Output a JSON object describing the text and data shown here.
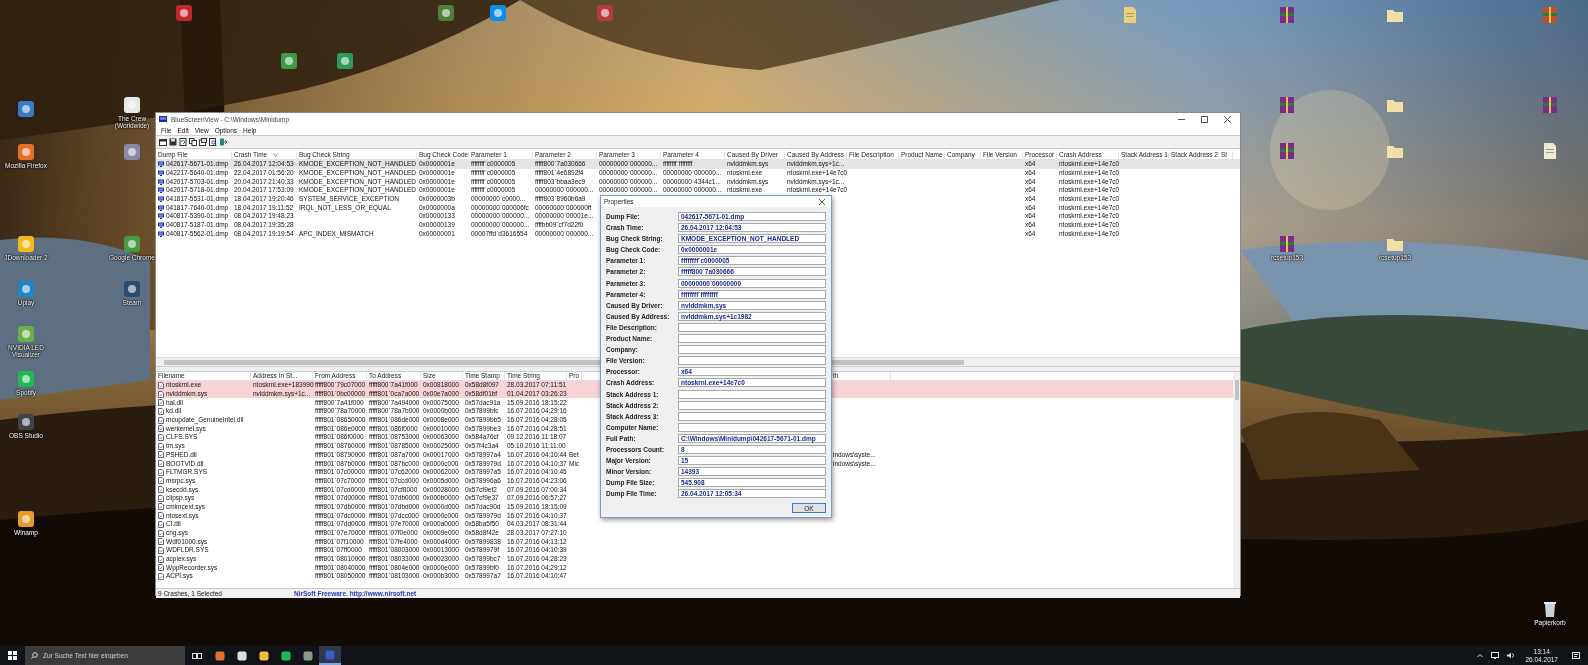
{
  "desktop_icons": [
    {
      "kind": "app",
      "color": "#c0282d"
    },
    {
      "kind": "app",
      "color": "#4f7f3a"
    },
    {
      "kind": "app",
      "color": "#0e8ee9"
    },
    {
      "kind": "app",
      "color": "#b83a3a"
    },
    {
      "kind": "app",
      "color": "#3c9a4a"
    },
    {
      "kind": "app",
      "color": "#2f9a5e"
    },
    {
      "kind": "document",
      "color": "#e8d27a"
    },
    {
      "kind": "archive",
      "color": "#7a2d8a"
    },
    {
      "kind": "folder",
      "color": "#f0e0a8"
    },
    {
      "kind": "archive",
      "color": "#b8502e"
    },
    {
      "kind": "app",
      "color": "#e8e8e8",
      "label": "The Crew (Worldwide)"
    },
    {
      "kind": "app",
      "color": "#3a78c8"
    },
    {
      "kind": "app",
      "color": "#e5702a",
      "label": "Mozilla Firefox"
    },
    {
      "kind": "app",
      "color": "#8a8aa8"
    },
    {
      "kind": "archive",
      "color": "#7a2d8a"
    },
    {
      "kind": "folder",
      "color": "#f0e0a8"
    },
    {
      "kind": "archive",
      "color": "#7a2d8a"
    },
    {
      "kind": "archive",
      "color": "#7a2d8a"
    },
    {
      "kind": "folder",
      "color": "#f0e0a8"
    },
    {
      "kind": "document",
      "color": "#f2ead0"
    },
    {
      "kind": "app",
      "color": "#f2b91c",
      "label": "JDownloader 2"
    },
    {
      "kind": "app",
      "color": "#4a9a44",
      "label": "Google Chrome"
    },
    {
      "kind": "archive",
      "color": "#7a2d8a",
      "label": "rcsetup153"
    },
    {
      "kind": "folder",
      "color": "#f0e0a8",
      "label": "rcsetup153"
    },
    {
      "kind": "app",
      "color": "#1e86c8",
      "label": "Uplay"
    },
    {
      "kind": "app",
      "color": "#2a4c6e",
      "label": "Steam"
    },
    {
      "kind": "app",
      "color": "#6ab04a",
      "label": "NVIDIA LED Visualizer"
    },
    {
      "kind": "app",
      "color": "#1db954",
      "label": "Spotify"
    },
    {
      "kind": "app",
      "color": "#404448",
      "label": "OBS Studio"
    },
    {
      "kind": "app",
      "color": "#e89a2a",
      "label": "Winamp"
    },
    {
      "kind": "bin",
      "color": "#c8d0d8",
      "label": "Papierkorb"
    }
  ],
  "window": {
    "title": "BlueScreenView  -  C:\\Windows\\Minidump",
    "menu": [
      "File",
      "Edit",
      "View",
      "Options",
      "Help"
    ],
    "crash_table": {
      "columns": [
        "Dump File",
        "Crash Time",
        "Bug Check String",
        "Bug Check Code",
        "Parameter 1",
        "Parameter 2",
        "Parameter 3",
        "Parameter 4",
        "Caused By Driver",
        "Caused By Address",
        "File Description",
        "Product Name",
        "Company",
        "File Version",
        "Processor",
        "Crash Address",
        "Stack Address 1",
        "Stack Address 2",
        "St"
      ],
      "rows": [
        {
          "selected": true,
          "dump_file": "042617-5671-01.dmp",
          "crash_time": "26.04.2017 12:04:53",
          "bug_check_string": "KMODE_EXCEPTION_NOT_HANDLED",
          "bug_check_code": "0x0000001e",
          "parameter_1": "ffffffff`c0000005",
          "parameter_2": "fffff800`7a030666",
          "parameter_3": "00000000`000000...",
          "parameter_4": "ffffffff`ffffffff",
          "caused_by_driver": "nvlddmkm.sys",
          "caused_by_address": "nvlddmkm.sys+1c...",
          "processor": "x64",
          "crash_address": "ntoskrnl.exe+14e7c0"
        },
        {
          "selected": false,
          "dump_file": "042217-5640-01.dmp",
          "crash_time": "22.04.2017 01:56:20",
          "bug_check_string": "KMODE_EXCEPTION_NOT_HANDLED",
          "bug_check_code": "0x0000001e",
          "parameter_1": "ffffffff`c0000005",
          "parameter_2": "fffff801`4e6892f4",
          "parameter_3": "00000000`000000...",
          "parameter_4": "00000000`000000...",
          "caused_by_driver": "ntoskrnl.exe",
          "caused_by_address": "ntoskrnl.exe+14e7c0",
          "processor": "x64",
          "crash_address": "ntoskrnl.exe+14e7c0"
        },
        {
          "selected": false,
          "dump_file": "042017-5703-01.dmp",
          "crash_time": "20.04.2017 21:40:33",
          "bug_check_string": "KMODE_EXCEPTION_NOT_HANDLED",
          "bug_check_code": "0x0000001e",
          "parameter_1": "ffffffff`c0000005",
          "parameter_2": "fffff803`bbaa3ec9",
          "parameter_3": "00000000`000000...",
          "parameter_4": "00000000`4344c1...",
          "caused_by_driver": "nvlddmkm.sys",
          "caused_by_address": "nvlddmkm.sys+1c...",
          "processor": "x64",
          "crash_address": "ntoskrnl.exe+14e7c0"
        },
        {
          "selected": false,
          "dump_file": "042017-5718-01.dmp",
          "crash_time": "20.04.2017 17:53:09",
          "bug_check_string": "KMODE_EXCEPTION_NOT_HANDLED",
          "bug_check_code": "0x0000001e",
          "parameter_1": "ffffffff`c0000005",
          "parameter_2": "00000000`000000...",
          "parameter_3": "00000000`000000...",
          "parameter_4": "00000000`000000...",
          "caused_by_driver": "ntoskrnl.exe",
          "caused_by_address": "ntoskrnl.exe+14e7c0",
          "processor": "x64",
          "crash_address": "ntoskrnl.exe+14e7c0"
        },
        {
          "selected": false,
          "dump_file": "041817-5531-01.dmp",
          "crash_time": "18.04.2017 19:20:46",
          "bug_check_string": "SYSTEM_SERVICE_EXCEPTION",
          "bug_check_code": "0x0000003b",
          "parameter_1": "00000000`c0000...",
          "parameter_2": "fffff803`8960b6a9",
          "processor": "x64",
          "crash_address": "ntoskrnl.exe+14e7c0"
        },
        {
          "selected": false,
          "dump_file": "041817-7640-01.dmp",
          "crash_time": "18.04.2017 19:11:52",
          "bug_check_string": "IRQL_NOT_LESS_OR_EQUAL",
          "bug_check_code": "0x0000000a",
          "parameter_1": "00000000`000006fc",
          "parameter_2": "00000000`000000ff",
          "processor": "x64",
          "crash_address": "ntoskrnl.exe+14e7c0"
        },
        {
          "selected": false,
          "dump_file": "040817-5390-01.dmp",
          "crash_time": "08.04.2017 19:48:23",
          "bug_check_code": "0x00000133",
          "parameter_1": "00000000`000000...",
          "parameter_2": "00000000`00001e...",
          "processor": "x64",
          "crash_address": "ntoskrnl.exe+14e7c0"
        },
        {
          "selected": false,
          "dump_file": "040817-5187-01.dmp",
          "crash_time": "08.04.2017 19:35:28",
          "bug_check_code": "0x00000139",
          "parameter_1": "00000000`000000...",
          "parameter_2": "ffffbb09`cf7d22f0",
          "processor": "x64",
          "crash_address": "ntoskrnl.exe+14e7c0"
        },
        {
          "selected": false,
          "dump_file": "040817-5562-01.dmp",
          "crash_time": "08.04.2017 19:19:54",
          "bug_check_string": "APC_INDEX_MISMATCH",
          "bug_check_code": "0x00000001",
          "parameter_1": "00007ffd`d3616554",
          "parameter_2": "00000000`000000...",
          "processor": "x64",
          "crash_address": "ntoskrnl.exe+14e7c0"
        }
      ]
    },
    "driver_table": {
      "columns": [
        "Filename",
        "Address In St...",
        "From Address",
        "To Address",
        "Size",
        "Time Stamp",
        "Time String",
        "Pro",
        "th"
      ],
      "rows": [
        {
          "highlighted": true,
          "filename": "ntoskrnl.exe",
          "address_in_stack": "ntoskrnl.exe+183990",
          "from_address": "fffff800`79c07000",
          "to_address": "fffff800`7a41f000",
          "size": "0x00818000",
          "time_stamp": "0x58d8f097",
          "time_string": "28.03.2017 07:11:51"
        },
        {
          "highlighted": true,
          "filename": "nvlddmkm.sys",
          "address_in_stack": "nvlddmkm.sys+1c...",
          "from_address": "fffff801`0bc00000",
          "to_address": "fffff801`0ca7a000",
          "size": "0x00e7a000",
          "time_stamp": "0x58df01bf",
          "time_string": "01.04.2017 03:26:23"
        },
        {
          "highlighted": false,
          "filename": "hal.dll",
          "from_address": "fffff800`7a41f000",
          "to_address": "fffff800`7a494000",
          "size": "0x00075000",
          "time_stamp": "0x57dac91a",
          "time_string": "15.09.2016 18:15:22"
        },
        {
          "highlighted": false,
          "filename": "kd.dll",
          "from_address": "fffff800`78a70000",
          "to_address": "fffff800`78a7b000",
          "size": "0x0000b000",
          "time_stamp": "0x57899bfc",
          "time_string": "16.07.2016 04:29:16"
        },
        {
          "highlighted": false,
          "filename": "mcupdate_GenuineIntel.dll",
          "from_address": "fffff801`08650000",
          "to_address": "fffff801`086de000",
          "size": "0x0008e000",
          "time_stamp": "0x57899bb5",
          "time_string": "16.07.2016 04:28:05"
        },
        {
          "highlighted": false,
          "filename": "werkernel.sys",
          "from_address": "fffff801`086e0000",
          "to_address": "fffff801`086f0000",
          "size": "0x00010000",
          "time_stamp": "0x57899be3",
          "time_string": "16.07.2016 04:28:51"
        },
        {
          "highlighted": false,
          "filename": "CLFS.SYS",
          "from_address": "fffff801`086f0000",
          "to_address": "fffff801`08753000",
          "size": "0x00063000",
          "time_stamp": "0x584a76cf",
          "time_string": "09.12.2016 11:18:07"
        },
        {
          "highlighted": false,
          "filename": "tm.sys",
          "from_address": "fffff801`08760000",
          "to_address": "fffff801`08785000",
          "size": "0x00025000",
          "time_stamp": "0x57f4c3a4",
          "time_string": "05.10.2016 11:11:00"
        },
        {
          "highlighted": false,
          "filename": "PSHED.dll",
          "from_address": "fffff801`08790000",
          "to_address": "fffff801`087a7000",
          "size": "0x00017000",
          "time_stamp": "0x578997a4",
          "time_string": "16.07.2016 04:10:44",
          "column_8": "Bet",
          "column_9": "indows\\syste..."
        },
        {
          "highlighted": false,
          "filename": "BOOTVID.dll",
          "from_address": "fffff801`087b0000",
          "to_address": "fffff801`087bc000",
          "size": "0x0000c000",
          "time_stamp": "0x5789979d",
          "time_string": "16.07.2016 04:10:37",
          "column_8": "Mic",
          "column_9": "indows\\syste..."
        },
        {
          "highlighted": false,
          "filename": "FLTMGR.SYS",
          "from_address": "fffff801`07c00000",
          "to_address": "fffff801`07c62000",
          "size": "0x00062000",
          "time_stamp": "0x578997a5",
          "time_string": "16.07.2016 04:10:45"
        },
        {
          "highlighted": false,
          "filename": "msrpc.sys",
          "from_address": "fffff801`07c70000",
          "to_address": "fffff801`07ccd000",
          "size": "0x0005d000",
          "time_stamp": "0x578996a6",
          "time_string": "16.07.2016 04:23:06"
        },
        {
          "highlighted": false,
          "filename": "ksecdd.sys",
          "from_address": "fffff801`07cd0000",
          "to_address": "fffff801`07cf8000",
          "size": "0x00028000",
          "time_stamp": "0x57cf9ef2",
          "time_string": "07.09.2016 07:00:34"
        },
        {
          "highlighted": false,
          "filename": "clipsp.sys",
          "from_address": "fffff801`07d00000",
          "to_address": "fffff801`07db0000",
          "size": "0x000b0000",
          "time_stamp": "0x57cf9e37",
          "time_string": "07.09.2016 06:57:27"
        },
        {
          "highlighted": false,
          "filename": "cmimcext.sys",
          "from_address": "fffff801`07db0000",
          "to_address": "fffff801`07dbd000",
          "size": "0x0000d000",
          "time_stamp": "0x57dac90d",
          "time_string": "15.09.2016 18:15:09"
        },
        {
          "highlighted": false,
          "filename": "ntosext.sys",
          "from_address": "fffff801`07dc0000",
          "to_address": "fffff801`07dcc000",
          "size": "0x0000c000",
          "time_stamp": "0x5789979d",
          "time_string": "16.07.2016 04:10:37"
        },
        {
          "highlighted": false,
          "filename": "CI.dll",
          "from_address": "fffff801`07dd0000",
          "to_address": "fffff801`07e70000",
          "size": "0x000a0000",
          "time_stamp": "0x58ba5f50",
          "time_string": "04.03.2017 08:31:44"
        },
        {
          "highlighted": false,
          "filename": "cng.sys",
          "from_address": "fffff801`07e70000",
          "to_address": "fffff801`07f0e000",
          "size": "0x0009e000",
          "time_stamp": "0x58d8f42e",
          "time_string": "28.03.2017 07:27:10"
        },
        {
          "highlighted": false,
          "filename": "Wdf01000.sys",
          "from_address": "fffff801`07f10000",
          "to_address": "fffff801`07fe4000",
          "size": "0x000d4000",
          "time_stamp": "0x57899838",
          "time_string": "16.07.2016 04:13:12"
        },
        {
          "highlighted": false,
          "filename": "WDFLDR.SYS",
          "from_address": "fffff801`07ff0000",
          "to_address": "fffff801`08003000",
          "size": "0x00013000",
          "time_stamp": "0x5789979f",
          "time_string": "16.07.2016 04:10:39"
        },
        {
          "highlighted": false,
          "filename": "acpiex.sys",
          "from_address": "fffff801`08010000",
          "to_address": "fffff801`08033000",
          "size": "0x00023000",
          "time_stamp": "0x57899bc7",
          "time_string": "16.07.2016 04:28:23"
        },
        {
          "highlighted": false,
          "filename": "WppRecorder.sys",
          "from_address": "fffff801`08040000",
          "to_address": "fffff801`0804e000",
          "size": "0x0000e000",
          "time_stamp": "0x57899bf0",
          "time_string": "16.07.2016 04:29:12"
        },
        {
          "highlighted": false,
          "filename": "ACPI.sys",
          "from_address": "fffff801`08050000",
          "to_address": "fffff801`08103000",
          "size": "0x000b3000",
          "time_stamp": "0x578997a7",
          "time_string": "16.07.2016 04:10:47"
        }
      ]
    },
    "status_bar": {
      "count": "9 Crashes, 1 Selected",
      "credit": "NirSoft Freeware.  http://www.nirsoft.net"
    }
  },
  "properties_dialog": {
    "title": "Properties",
    "fields": [
      {
        "label": "Dump File:",
        "value": "042617-5671-01.dmp"
      },
      {
        "label": "Crash Time:",
        "value": "26.04.2017 12:04:53"
      },
      {
        "label": "Bug Check String:",
        "value": "KMODE_EXCEPTION_NOT_HANDLED"
      },
      {
        "label": "Bug Check Code:",
        "value": "0x0000001e"
      },
      {
        "label": "Parameter 1:",
        "value": "ffffffff`c0000005"
      },
      {
        "label": "Parameter 2:",
        "value": "fffff800`7a030666"
      },
      {
        "label": "Parameter 3:",
        "value": "00000000`00000000"
      },
      {
        "label": "Parameter 4:",
        "value": "ffffffff`ffffffff"
      },
      {
        "label": "Caused By Driver:",
        "value": "nvlddmkm.sys"
      },
      {
        "label": "Caused By Address:",
        "value": "nvlddmkm.sys+1c1982"
      },
      {
        "label": "File Description:"
      },
      {
        "label": "Product Name:"
      },
      {
        "label": "Company:"
      },
      {
        "label": "File Version:"
      },
      {
        "label": "Processor:",
        "value": "x64"
      },
      {
        "label": "Crash Address:",
        "value": "ntoskrnl.exe+14e7c0"
      },
      {
        "label": "Stack Address 1:"
      },
      {
        "label": "Stack Address 2:"
      },
      {
        "label": "Stack Address 3:"
      },
      {
        "label": "Computer Name:"
      },
      {
        "label": "Full Path:",
        "value": "C:\\Windows\\Minidump\\042617-5671-01.dmp"
      },
      {
        "label": "Processors Count:",
        "value": "8"
      },
      {
        "label": "Major Version:",
        "value": "15"
      },
      {
        "label": "Minor Version:",
        "value": "14393"
      },
      {
        "label": "Dump File Size:",
        "value": "545.908"
      },
      {
        "label": "Dump File Time:",
        "value": "26.04.2017 12:05:34"
      }
    ],
    "ok_button": "OK"
  },
  "taskbar": {
    "search_placeholder": "Zur Suche Text hier eingeben",
    "apps": [
      {
        "color": "#e5702a",
        "active": false
      },
      {
        "color": "#dddddd",
        "active": false
      },
      {
        "color": "#f0c040",
        "active": false
      },
      {
        "color": "#1db954",
        "active": false
      },
      {
        "color": "#8a9a8a",
        "active": false
      },
      {
        "color": "#3a5ad0",
        "active": true
      }
    ],
    "time": "13:14",
    "date": "26.04.2017"
  }
}
